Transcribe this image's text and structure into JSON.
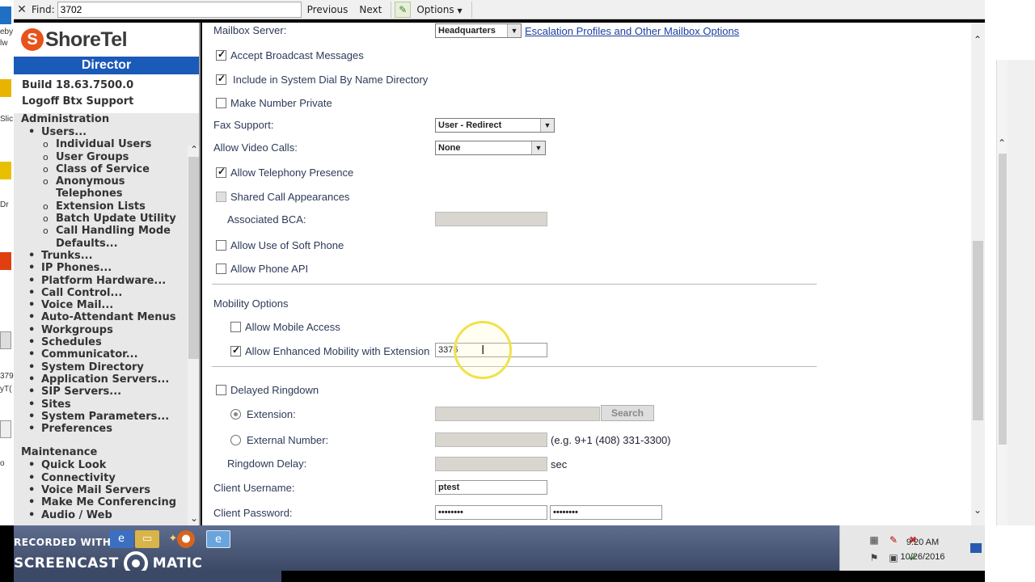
{
  "findbar": {
    "close": "✕",
    "label": "Find:",
    "value": "3702",
    "previous": "Previous",
    "next": "Next",
    "options": "Options"
  },
  "desktop_left": {
    "snippets": [
      "eby",
      "lw",
      "Slic",
      "Dr",
      "379",
      "yT(",
      "o"
    ]
  },
  "nav": {
    "logo_mark": "S",
    "brand": "ShoreTel",
    "product": "Director",
    "build": "Build 18.63.7500.0",
    "logoff": "Logoff Btx Support",
    "admin_header": "Administration",
    "admin_items": [
      {
        "label": "Users...",
        "level": 1
      },
      {
        "label": "Individual Users",
        "level": 2
      },
      {
        "label": "User Groups",
        "level": 2
      },
      {
        "label": "Class of Service",
        "level": 2
      },
      {
        "label": "Anonymous Telephones",
        "level": 2
      },
      {
        "label": "Extension Lists",
        "level": 2
      },
      {
        "label": "Batch Update Utility",
        "level": 2
      },
      {
        "label": "Call Handling Mode Defaults...",
        "level": 2
      },
      {
        "label": "Trunks...",
        "level": 1
      },
      {
        "label": "IP Phones...",
        "level": 1
      },
      {
        "label": "Platform Hardware...",
        "level": 1
      },
      {
        "label": "Call Control...",
        "level": 1
      },
      {
        "label": "Voice Mail...",
        "level": 1
      },
      {
        "label": "Auto-Attendant Menus",
        "level": 1
      },
      {
        "label": "Workgroups",
        "level": 1
      },
      {
        "label": "Schedules",
        "level": 1
      },
      {
        "label": "Communicator...",
        "level": 1
      },
      {
        "label": "System Directory",
        "level": 1
      },
      {
        "label": "Application Servers...",
        "level": 1
      },
      {
        "label": "SIP Servers...",
        "level": 1
      },
      {
        "label": "Sites",
        "level": 1
      },
      {
        "label": "System Parameters...",
        "level": 1
      },
      {
        "label": "Preferences",
        "level": 1
      }
    ],
    "maint_header": "Maintenance",
    "maint_items": [
      {
        "label": "Quick Look",
        "level": 1
      },
      {
        "label": "Connectivity",
        "level": 1
      },
      {
        "label": "Voice Mail Servers",
        "level": 1
      },
      {
        "label": "Make Me Conferencing",
        "level": 1
      },
      {
        "label": "Audio / Web",
        "level": 1
      }
    ]
  },
  "form": {
    "mailbox_server_label": "Mailbox Server:",
    "mailbox_server_value": "Headquarters",
    "escalation_link": "Escalation Profiles and Other Mailbox Options",
    "accept_broadcast": "Accept Broadcast Messages",
    "include_dial_by_name": "Include in System Dial By Name Directory",
    "make_number_private": "Make Number Private",
    "fax_support_label": "Fax Support:",
    "fax_support_value": "User - Redirect",
    "allow_video_label": "Allow Video Calls:",
    "allow_video_value": "None",
    "allow_telephony_presence": "Allow Telephony Presence",
    "shared_call_appearances": "Shared Call Appearances",
    "associated_bca_label": "Associated BCA:",
    "allow_soft_phone": "Allow Use of Soft Phone",
    "allow_phone_api": "Allow Phone API",
    "mobility_header": "Mobility Options",
    "allow_mobile_access": "Allow Mobile Access",
    "allow_enhanced_mobility": "Allow Enhanced Mobility with Extension",
    "enhanced_mobility_ext": "3376",
    "delayed_ringdown": "Delayed Ringdown",
    "extension_label": "Extension:",
    "search_button": "Search",
    "external_number_label": "External Number:",
    "external_number_hint": "(e.g. 9+1 (408) 331-3300)",
    "ringdown_delay_label": "Ringdown Delay:",
    "ringdown_unit": "sec",
    "client_username_label": "Client Username:",
    "client_username_value": "ptest",
    "client_password_label": "Client Password:",
    "client_password_value": "••••••••",
    "client_password_confirm": "••••••••"
  },
  "taskbar": {
    "watermark_top": "RECORDED WITH",
    "watermark_brand_left": "SCREENCAST",
    "watermark_brand_right": "MATIC",
    "time": "9:20 AM",
    "date": "10/26/2016"
  },
  "colors": {
    "brand_orange": "#e8531c",
    "director_blue": "#1a5ab8",
    "link_blue": "#1a3fa0",
    "label_navy": "#2d3a58",
    "cursor_highlight": "#f0e24a"
  }
}
